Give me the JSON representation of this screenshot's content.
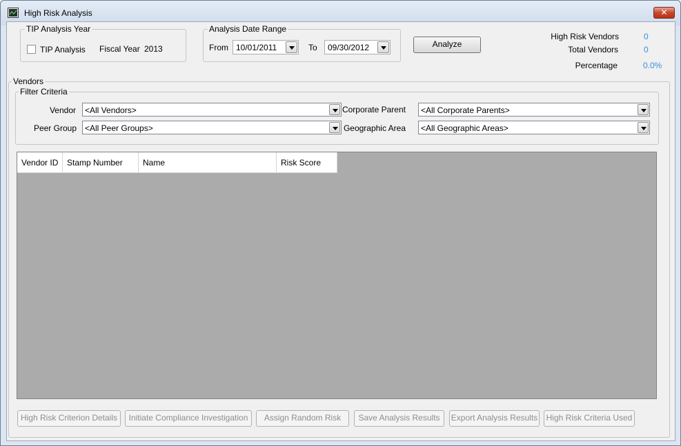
{
  "window": {
    "title": "High Risk Analysis",
    "close_label": "✕"
  },
  "tip_group": {
    "label": "TIP Analysis Year",
    "checkbox_label": "TIP Analysis",
    "checked": false,
    "fiscal_year_label": "Fiscal Year",
    "fiscal_year_value": "2013"
  },
  "date_range": {
    "label": "Analysis Date Range",
    "from_label": "From",
    "from_value": "10/01/2011",
    "to_label": "To",
    "to_value": "09/30/2012"
  },
  "analyze_button": "Analyze",
  "stats": {
    "high_risk_label": "High Risk Vendors",
    "high_risk_value": "0",
    "total_label": "Total Vendors",
    "total_value": "0",
    "percentage_label": "Percentage",
    "percentage_value": "0.0%"
  },
  "vendors_group": {
    "label": "Vendors",
    "filter_label": "Filter Criteria",
    "vendor_label": "Vendor",
    "vendor_value": "<All Vendors>",
    "peer_group_label": "Peer Group",
    "peer_group_value": "<All Peer Groups>",
    "corporate_parent_label": "Corporate Parent",
    "corporate_parent_value": "<All Corporate Parents>",
    "geographic_area_label": "Geographic Area",
    "geographic_area_value": "<All Geographic Areas>"
  },
  "grid": {
    "columns": [
      "Vendor ID",
      "Stamp Number",
      "Name",
      "Risk Score"
    ],
    "rows": []
  },
  "bottom_buttons": {
    "criterion_details": "High Risk Criterion Details",
    "initiate_compliance": "Initiate Compliance Investigation",
    "assign_random": "Assign Random Risk",
    "save_results": "Save Analysis Results",
    "export_results": "Export Analysis Results",
    "criteria_used": "High Risk Criteria Used"
  },
  "colors": {
    "stat_value": "#3a8ee0",
    "grid_background": "#ababab"
  }
}
